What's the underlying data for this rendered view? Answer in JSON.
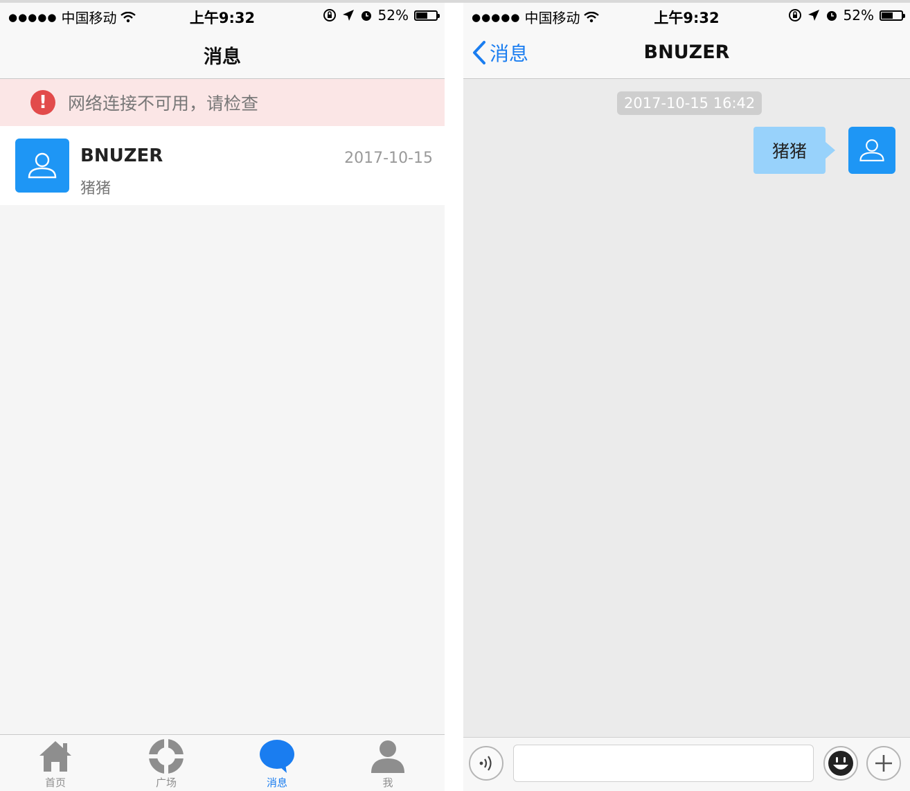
{
  "status_bar": {
    "signal_dots": "●●●●●",
    "carrier": "中国移动",
    "time": "上午9:32",
    "battery": "52%",
    "icons": [
      "wifi-icon",
      "rotation-lock-icon",
      "location-icon",
      "alarm-icon",
      "battery-icon"
    ]
  },
  "messages_screen": {
    "title": "消息",
    "alert": {
      "text": "网络连接不可用，请检查",
      "icon": "!"
    },
    "conversations": [
      {
        "name": "BNUZER",
        "preview": "猪猪",
        "date": "2017-10-15"
      }
    ],
    "tabs": [
      {
        "label": "首页",
        "icon": "home-icon",
        "active": false
      },
      {
        "label": "广场",
        "icon": "square-icon",
        "active": false
      },
      {
        "label": "消息",
        "icon": "message-icon",
        "active": true
      },
      {
        "label": "我",
        "icon": "profile-icon",
        "active": false
      }
    ]
  },
  "chat_screen": {
    "back_label": "消息",
    "title": "BNUZER",
    "timestamp": "2017-10-15 16:42",
    "messages": [
      {
        "text": "猪猪",
        "from": "self"
      }
    ],
    "input": {
      "value": "",
      "placeholder": ""
    }
  },
  "colors": {
    "accent": "#1a7df0",
    "avatar_blue": "#1e96f5",
    "bubble": "#98d2fb",
    "alert_bg": "#fbe6e6",
    "alert_icon": "#e24b4b"
  }
}
